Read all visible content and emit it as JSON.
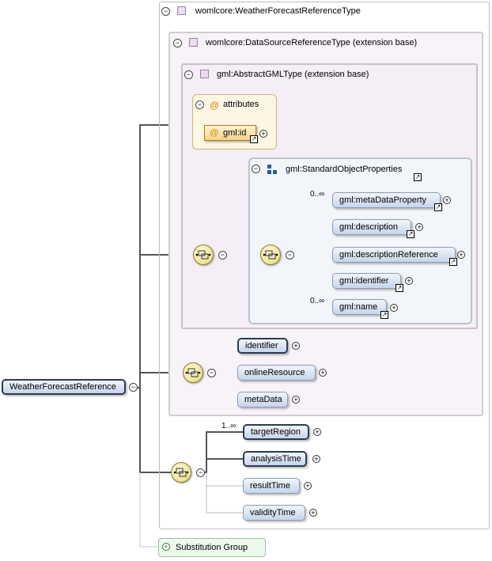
{
  "root": {
    "label": "WeatherForecastReference"
  },
  "outer_type": {
    "label": "womlcore:WeatherForecastReferenceType"
  },
  "base1": {
    "label": "womlcore:DataSourceReferenceType (extension base)"
  },
  "base2": {
    "label": "gml:AbstractGMLType (extension base)"
  },
  "attributes": {
    "group_label": "attributes",
    "at": "@",
    "id_label": "gml:id"
  },
  "std_props": {
    "label": "gml:StandardObjectProperties",
    "items": [
      {
        "label": "gml:metaDataProperty",
        "occurs": "0..∞"
      },
      {
        "label": "gml:description",
        "occurs": ""
      },
      {
        "label": "gml:descriptionReference",
        "occurs": ""
      },
      {
        "label": "gml:identifier",
        "occurs": ""
      },
      {
        "label": "gml:name",
        "occurs": "0..∞"
      }
    ]
  },
  "ds_seq": [
    {
      "label": "identifier"
    },
    {
      "label": "onlineResource"
    },
    {
      "label": "metaData"
    }
  ],
  "wf_seq": [
    {
      "label": "targetRegion",
      "occurs": "1..∞"
    },
    {
      "label": "analysisTime",
      "occurs": ""
    },
    {
      "label": "resultTime",
      "occurs": ""
    },
    {
      "label": "validityTime",
      "occurs": ""
    }
  ],
  "substitution": {
    "label": "Substitution Group"
  },
  "symbols": {
    "collapse": "−",
    "expand": "+",
    "link": "↗"
  }
}
